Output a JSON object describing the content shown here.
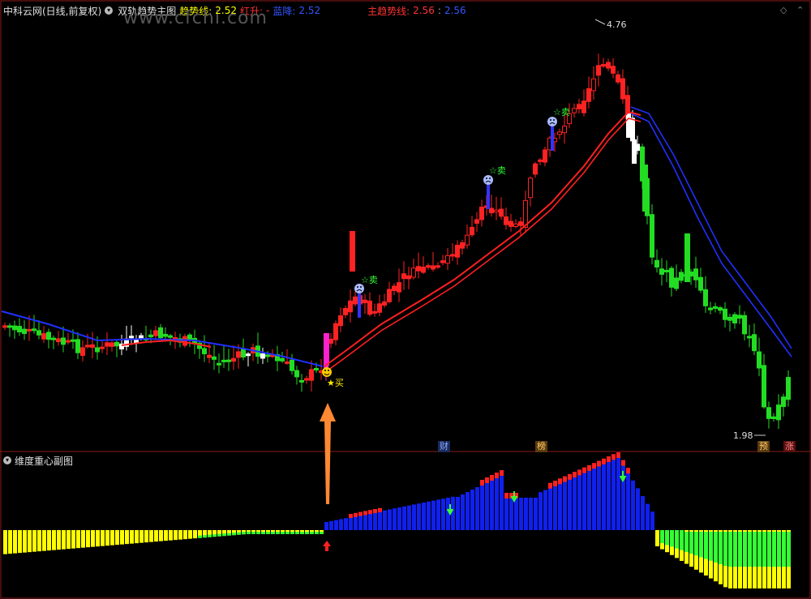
{
  "header": {
    "stock": "中科云网(日线,前复权)",
    "indicator": "双轨趋势主图",
    "trend_label": "趋势线:",
    "trend_value": "2.52",
    "red_label": "红升:",
    "red_value": "-",
    "blue_label": "蓝降:",
    "blue_value": "2.52",
    "main_label": "主趋势线:",
    "main_value": "2.56",
    "main_value2": "2.56"
  },
  "watermark": "www.cfchi.com",
  "sub_header": {
    "title": "维度重心副图"
  },
  "annotations": {
    "high": "4.76",
    "low": "1.98",
    "buy": "★买",
    "sell1": "☆卖",
    "sell2": "☆卖",
    "sell3": "☆卖"
  },
  "badges": {
    "cai": "财",
    "bang": "榜",
    "yu": "预",
    "zhang": "涨"
  },
  "colors": {
    "up": "#ff2222",
    "down": "#22dd22",
    "white": "#ffffff",
    "trend_red": "#ff2020",
    "trend_blue": "#2030ff",
    "sub_yellow": "#ffff00",
    "sub_green": "#33ff33",
    "sub_red": "#ff2020",
    "sub_blue": "#1020ee",
    "arrow": "#ff8833"
  },
  "chart_data": {
    "type": "candlestick",
    "ylim": [
      1.9,
      4.85
    ],
    "high_mark": 4.76,
    "low_mark": 1.98,
    "sub_type": "bar",
    "sub_ylim": [
      -1,
      1
    ]
  }
}
